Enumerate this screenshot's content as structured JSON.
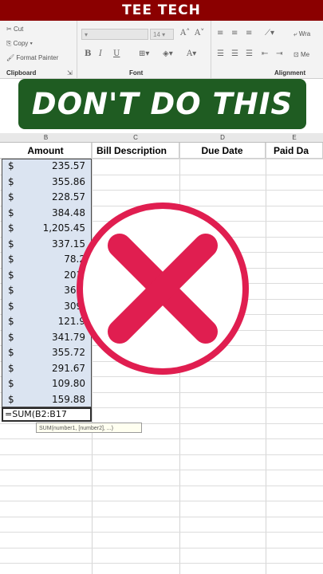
{
  "topbar": {
    "title": "TEE TECH"
  },
  "ribbon": {
    "clipboard": {
      "cut": "Cut",
      "copy": "Copy",
      "format_painter": "Format Painter",
      "label": "Clipboard"
    },
    "font": {
      "size": "14",
      "label": "Font",
      "bold": "B",
      "italic": "I",
      "underline": "U"
    },
    "alignment": {
      "label": "Alignment",
      "wrap": "Wra",
      "merge": "Me"
    }
  },
  "banner": {
    "text": "DON'T DO THIS"
  },
  "columns": {
    "letters": [
      "B",
      "C",
      "D",
      "E"
    ],
    "headers": [
      "Amount",
      "Bill Description",
      "Due Date",
      "Paid Da"
    ]
  },
  "rows": [
    {
      "currency": "$",
      "amount": "235.57"
    },
    {
      "currency": "$",
      "amount": "355.86"
    },
    {
      "currency": "$",
      "amount": "228.57"
    },
    {
      "currency": "$",
      "amount": "384.48"
    },
    {
      "currency": "$",
      "amount": "1,205.45"
    },
    {
      "currency": "$",
      "amount": "337.15"
    },
    {
      "currency": "$",
      "amount": "78.2"
    },
    {
      "currency": "$",
      "amount": "201."
    },
    {
      "currency": "$",
      "amount": "361."
    },
    {
      "currency": "$",
      "amount": "309."
    },
    {
      "currency": "$",
      "amount": "121.9"
    },
    {
      "currency": "$",
      "amount": "341.79"
    },
    {
      "currency": "$",
      "amount": "355.72"
    },
    {
      "currency": "$",
      "amount": "291.67"
    },
    {
      "currency": "$",
      "amount": "109.80"
    },
    {
      "currency": "$",
      "amount": "159.88"
    }
  ],
  "formula_cell": {
    "text": "=SUM(B2:B17"
  },
  "tooltip": {
    "text": "SUM(number1, [number2], ...)"
  },
  "colors": {
    "topbar": "#8b0000",
    "banner": "#1f5c22",
    "xmark": "#e01e50",
    "selection": "#dbe4f1"
  }
}
